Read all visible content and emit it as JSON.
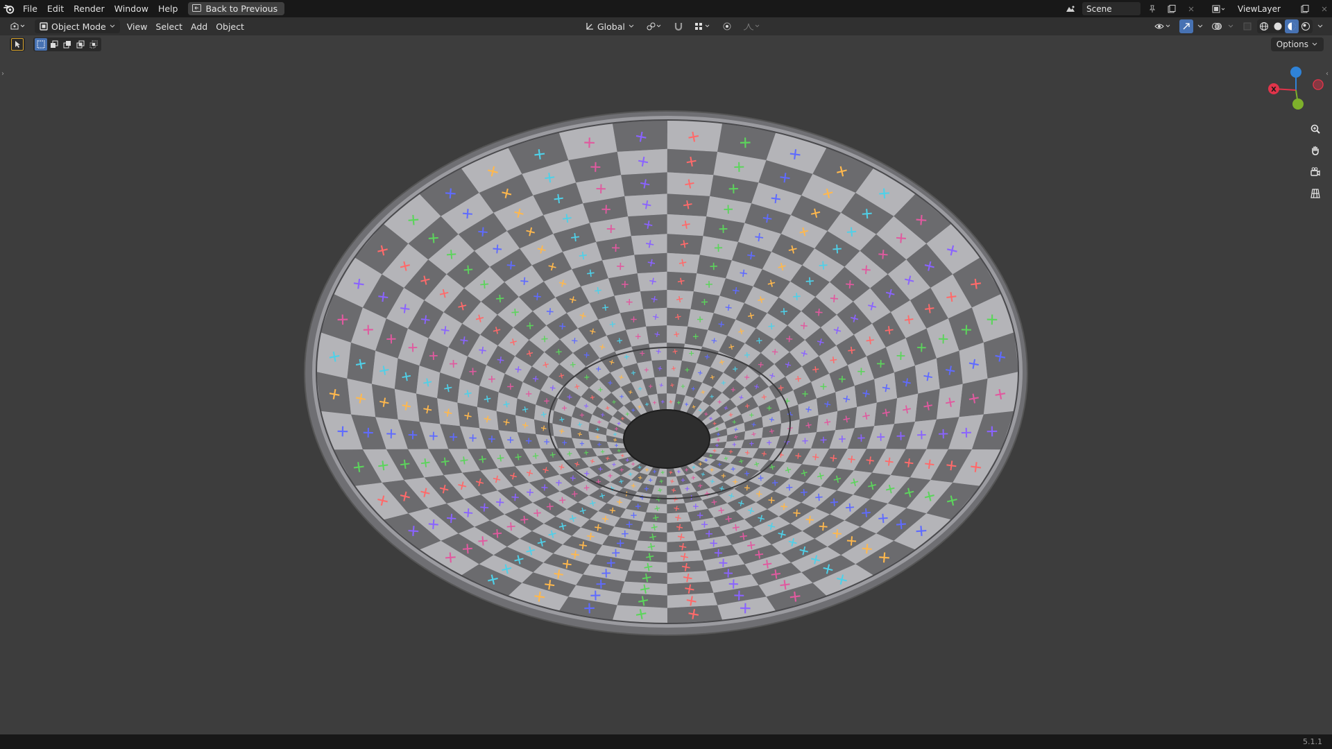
{
  "menu": {
    "items": [
      "File",
      "Edit",
      "Render",
      "Window",
      "Help"
    ],
    "back_button": "Back to Previous"
  },
  "top_right": {
    "scene": "Scene",
    "view_layer": "ViewLayer"
  },
  "header": {
    "mode": "Object Mode",
    "menus": [
      "View",
      "Select",
      "Add",
      "Object"
    ],
    "orientation": "Global"
  },
  "toolbar": {
    "options_label": "Options"
  },
  "gizmo": {
    "x_label": "X"
  },
  "status": {
    "version": "5.1.1"
  },
  "colors": {
    "accent": "#4772b3",
    "axis_x": "#e0344a",
    "axis_y": "#7eb02b",
    "axis_z": "#2f83d8",
    "checker_light": "#b4b4b8",
    "checker_dark": "#6b6b6e",
    "marker_palette": [
      "#e05a9f",
      "#ffb84d",
      "#5cd45c",
      "#8a63ff",
      "#4fd0e8",
      "#5f6bff",
      "#ff6a6a"
    ]
  }
}
